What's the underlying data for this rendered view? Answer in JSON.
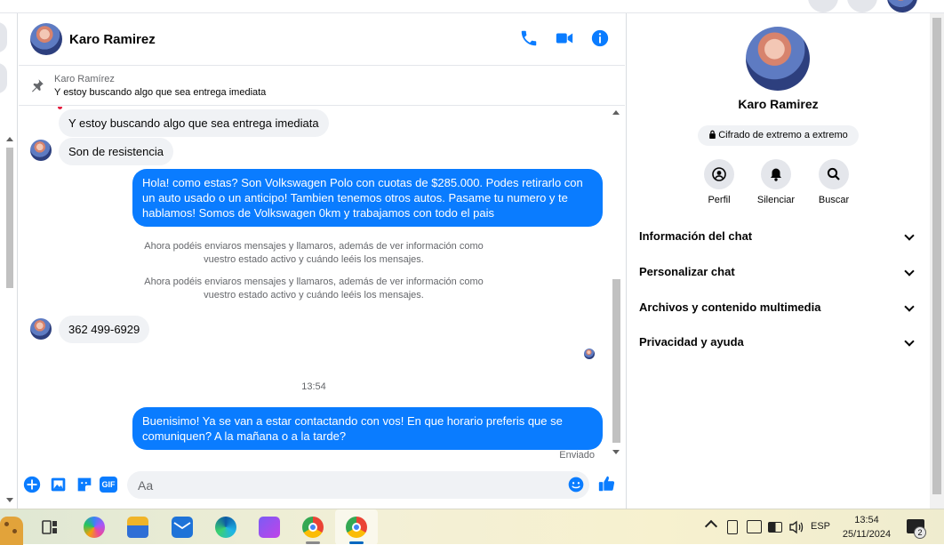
{
  "contact": {
    "name": "Karo Ramirez"
  },
  "pinned": {
    "sender": "Karo Ramírez",
    "text": "Y estoy buscando algo que sea entrega imediata"
  },
  "messages": {
    "in1": "Y estoy buscando algo que sea entrega imediata",
    "in2": "Son de resistencia",
    "out1": "Hola! como estas?  Son Volkswagen Polo con cuotas de $285.000. Podes retirarlo con un auto usado o un anticipo! Tambien tenemos otros autos. Pasame tu numero y te hablamos! Somos de Volkswagen 0km y trabajamos con todo el pais",
    "sys1": "Ahora podéis enviaros mensajes y llamaros, además de ver información como vuestro estado activo y cuándo leéis los mensajes.",
    "sys2": "Ahora podéis enviaros mensajes y llamaros, además de ver información como vuestro estado activo y cuándo leéis los mensajes.",
    "in3": "362 499-6929",
    "timestamp": "13:54",
    "out2": "Buenisimo! Ya se van a estar contactando con vos! En que horario preferis que se comuniquen? A la mañana o a la tarde?",
    "status": "Enviado"
  },
  "composer": {
    "placeholder": "Aa",
    "gif_label": "GIF"
  },
  "info_panel": {
    "name": "Karo Ramirez",
    "encryption": "Cifrado de extremo a extremo",
    "actions": [
      "Perfil",
      "Silenciar",
      "Buscar"
    ],
    "sections": [
      "Información del chat",
      "Personalizar chat",
      "Archivos y contenido multimedia",
      "Privacidad y ayuda"
    ]
  },
  "taskbar": {
    "lang": "ESP",
    "time": "13:54",
    "date": "25/11/2024",
    "notif_count": "2"
  },
  "colors": {
    "accent": "#0a7cff",
    "bubble_in": "#f0f2f5"
  },
  "icons": [
    "call-icon",
    "video-icon",
    "info-icon",
    "pin-icon",
    "plus-icon",
    "image-icon",
    "sticker-icon",
    "gif-icon",
    "emoji-icon",
    "like-icon",
    "lock-icon",
    "profile-icon",
    "bell-icon",
    "search-icon",
    "chevron-down-icon"
  ]
}
